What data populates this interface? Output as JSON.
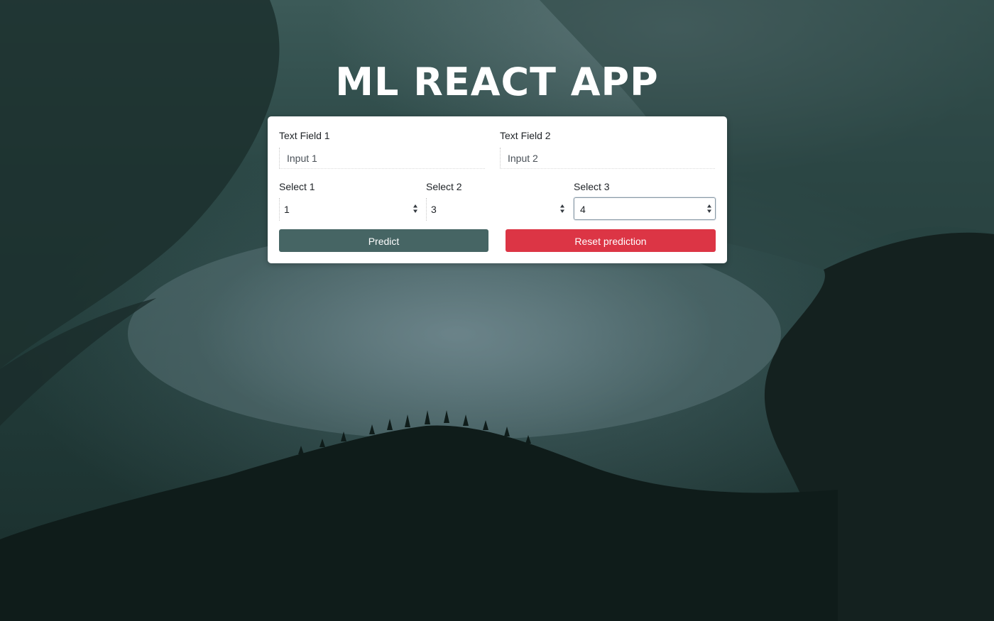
{
  "app": {
    "title": "ML REACT APP"
  },
  "form": {
    "text_field_1": {
      "label": "Text Field 1",
      "placeholder": "Input 1",
      "value": ""
    },
    "text_field_2": {
      "label": "Text Field 2",
      "placeholder": "Input 2",
      "value": ""
    },
    "select_1": {
      "label": "Select 1",
      "value": "1"
    },
    "select_2": {
      "label": "Select 2",
      "value": "3"
    },
    "select_3": {
      "label": "Select 3",
      "value": "4"
    },
    "predict_label": "Predict",
    "reset_label": "Reset prediction"
  },
  "colors": {
    "predict_button": "#466564",
    "reset_button": "#dc3545",
    "card_background": "#ffffff",
    "title_text": "#ffffff"
  },
  "icons": {
    "select_arrows": "sort-arrows-icon"
  }
}
